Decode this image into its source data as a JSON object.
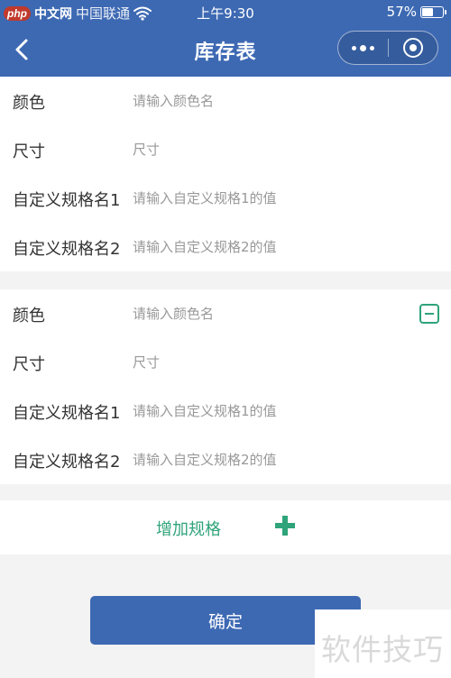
{
  "status_bar": {
    "logo_text": "php",
    "site_name": "中文网",
    "carrier": "中国联通",
    "time": "上午9:30",
    "battery_text": "57%",
    "battery_level": 0.57
  },
  "nav": {
    "title": "库存表"
  },
  "specs": [
    {
      "color_label": "颜色",
      "color_placeholder": "请输入颜色名",
      "size_label": "尺寸",
      "size_placeholder": "尺寸",
      "custom1_label": "自定义规格名1",
      "custom1_placeholder": "请输入自定义规格1的值",
      "custom2_label": "自定义规格名2",
      "custom2_placeholder": "请输入自定义规格2的值"
    },
    {
      "color_label": "颜色",
      "color_placeholder": "请输入颜色名",
      "size_label": "尺寸",
      "size_placeholder": "尺寸",
      "custom1_label": "自定义规格名1",
      "custom1_placeholder": "请输入自定义规格1的值",
      "custom2_label": "自定义规格名2",
      "custom2_placeholder": "请输入自定义规格2的值"
    }
  ],
  "add_spec_label": "增加规格",
  "confirm_label": "确定",
  "watermark": "软件技巧",
  "colors": {
    "primary": "#3d69b3",
    "accent": "#2fa37a",
    "background": "#f3f3f3"
  }
}
